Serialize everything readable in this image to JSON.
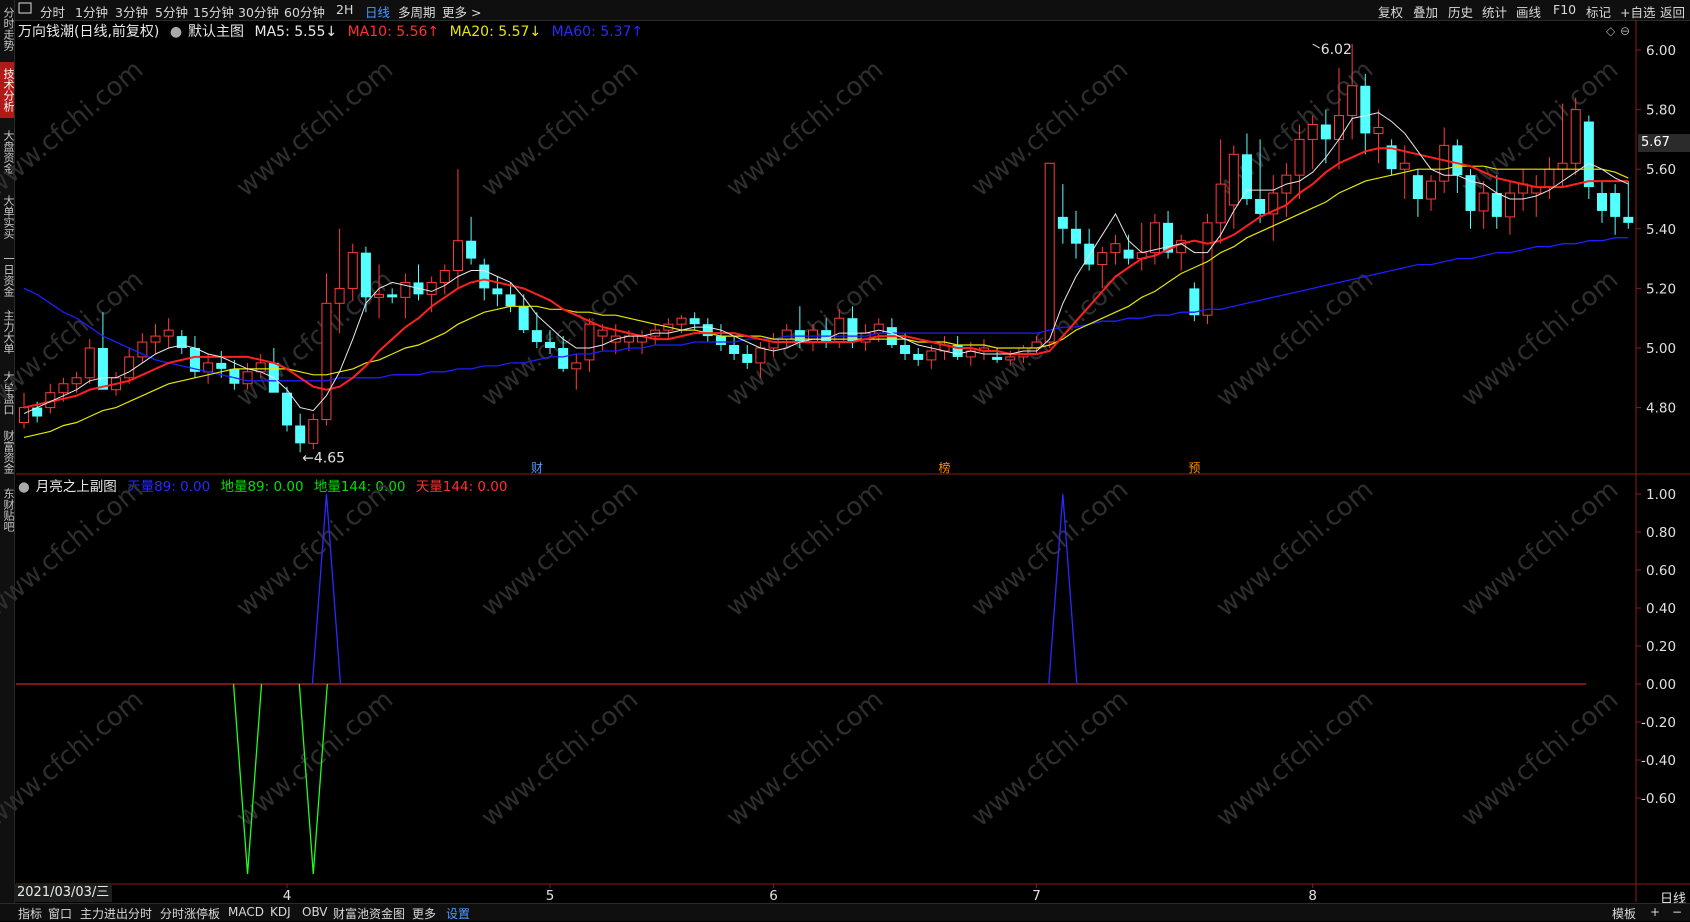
{
  "top_tabs": [
    "分时",
    "1分钟",
    "3分钟",
    "5分钟",
    "15分钟",
    "30分钟",
    "60分钟",
    "2H",
    "日线",
    "多周期",
    "更多 >"
  ],
  "active_tab": "日线",
  "right_menu": [
    "复权",
    "叠加",
    "历史",
    "统计",
    "画线",
    "F10",
    "标记",
    "+自选",
    "返回"
  ],
  "sidebar": [
    "分时走势",
    "技术分析",
    "大盘资金",
    "大单实买",
    "一日资金",
    "主力大单",
    "大单盘口",
    "财富资金",
    "东财贴吧"
  ],
  "active_side": "技术分析",
  "stock_title": "万向钱潮(日线,前复权)",
  "main_indicator": "默认主图",
  "ma": [
    {
      "label": "MA5: 5.55↓",
      "color": "#e8e8e8"
    },
    {
      "label": "MA10: 5.56↑",
      "color": "#ff3030"
    },
    {
      "label": "MA20: 5.57↓",
      "color": "#e6e600"
    },
    {
      "label": "MA60: 5.37↑",
      "color": "#2a2aff"
    }
  ],
  "sub_title": "月亮之上副图",
  "sub_lines": [
    {
      "label": "天量89: 0.00",
      "color": "#2a2aff"
    },
    {
      "label": "地量89: 0.00",
      "color": "#00e000"
    },
    {
      "label": "地量144: 0.00",
      "color": "#00e000"
    },
    {
      "label": "天量144: 0.00",
      "color": "#ff3030"
    }
  ],
  "current_price": "5.67",
  "high_label": "6.02",
  "low_label": "←4.65",
  "event_marks": [
    "财",
    "榜",
    "预"
  ],
  "price_axis": [
    "6.00",
    "5.80",
    "5.60",
    "5.40",
    "5.20",
    "5.00",
    "4.80"
  ],
  "sub_axis": [
    "1.00",
    "0.80",
    "0.60",
    "0.40",
    "0.20",
    "0.00",
    "-0.20",
    "-0.40",
    "-0.60"
  ],
  "x_labels": [
    "4",
    "5",
    "6",
    "7",
    "8"
  ],
  "date_label": "2021/03/03/三",
  "period_label": "日线",
  "bottom_tabs": [
    "指标",
    "窗口",
    "主力进出分时",
    "分时涨停板",
    "MACD",
    "KDJ",
    "OBV",
    "财富池资金图",
    "更多",
    "设置"
  ],
  "active_bottom": "设置",
  "bottom_right": [
    "模板",
    "+",
    "−"
  ],
  "watermark": "www.cfchi.com",
  "colors": {
    "up": "#ff3b3b",
    "down": "#54ffff",
    "ma5": "#e8e8e8",
    "ma10": "#ff2020",
    "ma20": "#e6e600",
    "ma60": "#1e1eff"
  },
  "chart_data": {
    "type": "candlestick",
    "period": "daily",
    "ylim": [
      4.6,
      6.08
    ],
    "candles_ohlc": [
      [
        4.75,
        4.85,
        4.73,
        4.8
      ],
      [
        4.8,
        4.82,
        4.75,
        4.77
      ],
      [
        4.8,
        4.88,
        4.78,
        4.85
      ],
      [
        4.85,
        4.9,
        4.82,
        4.88
      ],
      [
        4.88,
        4.92,
        4.85,
        4.9
      ],
      [
        4.9,
        5.03,
        4.88,
        5.0
      ],
      [
        5.0,
        5.12,
        4.88,
        4.86
      ],
      [
        4.86,
        4.92,
        4.84,
        4.9
      ],
      [
        4.9,
        5.0,
        4.88,
        4.97
      ],
      [
        4.97,
        5.05,
        4.95,
        5.02
      ],
      [
        5.02,
        5.08,
        4.98,
        5.04
      ],
      [
        5.04,
        5.1,
        5.0,
        5.06
      ],
      [
        5.04,
        5.06,
        4.98,
        5.0
      ],
      [
        5.0,
        5.04,
        4.9,
        4.92
      ],
      [
        4.92,
        4.98,
        4.88,
        4.95
      ],
      [
        4.95,
        4.99,
        4.9,
        4.93
      ],
      [
        4.93,
        4.96,
        4.86,
        4.88
      ],
      [
        4.88,
        4.95,
        4.86,
        4.92
      ],
      [
        4.92,
        4.98,
        4.9,
        4.95
      ],
      [
        4.95,
        5.0,
        4.88,
        4.85
      ],
      [
        4.85,
        4.87,
        4.72,
        4.74
      ],
      [
        4.74,
        4.78,
        4.65,
        4.68
      ],
      [
        4.68,
        4.78,
        4.66,
        4.76
      ],
      [
        4.76,
        5.25,
        4.74,
        5.15
      ],
      [
        5.15,
        5.4,
        5.05,
        5.2
      ],
      [
        5.2,
        5.35,
        5.16,
        5.32
      ],
      [
        5.32,
        5.34,
        5.12,
        5.17
      ],
      [
        5.17,
        5.28,
        5.1,
        5.18
      ],
      [
        5.18,
        5.2,
        5.15,
        5.17
      ],
      [
        5.17,
        5.25,
        5.1,
        5.22
      ],
      [
        5.22,
        5.28,
        5.16,
        5.18
      ],
      [
        5.18,
        5.24,
        5.12,
        5.22
      ],
      [
        5.22,
        5.28,
        5.18,
        5.26
      ],
      [
        5.26,
        5.6,
        5.2,
        5.36
      ],
      [
        5.36,
        5.44,
        5.28,
        5.3
      ],
      [
        5.28,
        5.3,
        5.16,
        5.2
      ],
      [
        5.2,
        5.24,
        5.14,
        5.18
      ],
      [
        5.18,
        5.22,
        5.12,
        5.14
      ],
      [
        5.14,
        5.18,
        5.05,
        5.06
      ],
      [
        5.06,
        5.12,
        5.0,
        5.02
      ],
      [
        5.02,
        5.06,
        4.98,
        5.0
      ],
      [
        5.0,
        5.04,
        4.92,
        4.93
      ],
      [
        4.93,
        4.98,
        4.86,
        4.95
      ],
      [
        4.96,
        5.1,
        4.92,
        5.08
      ],
      [
        5.04,
        5.08,
        4.99,
        5.06
      ],
      [
        5.02,
        5.08,
        4.98,
        5.04
      ],
      [
        5.02,
        5.06,
        4.99,
        5.04
      ],
      [
        5.02,
        5.06,
        4.98,
        5.04
      ],
      [
        5.04,
        5.08,
        5.01,
        5.06
      ],
      [
        5.06,
        5.1,
        5.03,
        5.08
      ],
      [
        5.08,
        5.11,
        5.05,
        5.1
      ],
      [
        5.1,
        5.12,
        5.06,
        5.08
      ],
      [
        5.08,
        5.1,
        5.02,
        5.04
      ],
      [
        5.04,
        5.08,
        4.99,
        5.01
      ],
      [
        5.01,
        5.04,
        4.96,
        4.98
      ],
      [
        4.98,
        5.01,
        4.93,
        4.95
      ],
      [
        4.95,
        5.02,
        4.9,
        5.0
      ],
      [
        5.0,
        5.05,
        4.97,
        5.03
      ],
      [
        5.03,
        5.08,
        5.0,
        5.06
      ],
      [
        5.06,
        5.14,
        5.0,
        5.02
      ],
      [
        5.02,
        5.08,
        4.99,
        5.06
      ],
      [
        5.06,
        5.1,
        5.0,
        5.02
      ],
      [
        5.02,
        5.13,
        5.0,
        5.1
      ],
      [
        5.1,
        5.14,
        5.0,
        5.02
      ],
      [
        5.02,
        5.08,
        4.99,
        5.05
      ],
      [
        5.05,
        5.1,
        5.02,
        5.08
      ],
      [
        5.07,
        5.1,
        5.0,
        5.01
      ],
      [
        5.01,
        5.05,
        4.96,
        4.98
      ],
      [
        4.98,
        5.0,
        4.94,
        4.96
      ],
      [
        4.96,
        5.01,
        4.93,
        4.99
      ],
      [
        4.99,
        5.04,
        4.96,
        5.01
      ],
      [
        5.01,
        5.04,
        4.96,
        4.97
      ],
      [
        4.97,
        5.02,
        4.94,
        4.99
      ],
      [
        4.99,
        5.03,
        4.96,
        5.0
      ],
      [
        4.97,
        5.0,
        4.95,
        4.96
      ],
      [
        4.96,
        4.99,
        4.94,
        4.97
      ],
      [
        4.97,
        5.01,
        4.95,
        5.0
      ],
      [
        5.0,
        5.04,
        4.98,
        5.02
      ],
      [
        5.02,
        5.62,
        5.0,
        5.62
      ],
      [
        5.44,
        5.55,
        5.35,
        5.4
      ],
      [
        5.4,
        5.46,
        5.3,
        5.35
      ],
      [
        5.35,
        5.4,
        5.26,
        5.28
      ],
      [
        5.28,
        5.34,
        5.2,
        5.32
      ],
      [
        5.32,
        5.38,
        5.28,
        5.35
      ],
      [
        5.33,
        5.38,
        5.28,
        5.3
      ],
      [
        5.3,
        5.42,
        5.26,
        5.32
      ],
      [
        5.32,
        5.45,
        5.28,
        5.42
      ],
      [
        5.42,
        5.46,
        5.3,
        5.32
      ],
      [
        5.32,
        5.38,
        5.26,
        5.36
      ],
      [
        5.2,
        5.22,
        5.09,
        5.11
      ],
      [
        5.11,
        5.45,
        5.08,
        5.42
      ],
      [
        5.42,
        5.7,
        5.35,
        5.55
      ],
      [
        5.48,
        5.68,
        5.4,
        5.65
      ],
      [
        5.65,
        5.72,
        5.48,
        5.5
      ],
      [
        5.5,
        5.7,
        5.42,
        5.45
      ],
      [
        5.45,
        5.58,
        5.36,
        5.52
      ],
      [
        5.52,
        5.62,
        5.44,
        5.58
      ],
      [
        5.58,
        5.75,
        5.5,
        5.7
      ],
      [
        5.7,
        5.78,
        5.6,
        5.75
      ],
      [
        5.75,
        5.8,
        5.62,
        5.7
      ],
      [
        5.7,
        5.94,
        5.6,
        5.78
      ],
      [
        5.78,
        6.02,
        5.7,
        5.88
      ],
      [
        5.88,
        5.92,
        5.65,
        5.72
      ],
      [
        5.72,
        5.8,
        5.62,
        5.74
      ],
      [
        5.68,
        5.7,
        5.58,
        5.6
      ],
      [
        5.6,
        5.68,
        5.5,
        5.62
      ],
      [
        5.58,
        5.6,
        5.44,
        5.5
      ],
      [
        5.5,
        5.58,
        5.46,
        5.56
      ],
      [
        5.56,
        5.74,
        5.52,
        5.68
      ],
      [
        5.68,
        5.7,
        5.52,
        5.58
      ],
      [
        5.58,
        5.6,
        5.4,
        5.46
      ],
      [
        5.46,
        5.56,
        5.4,
        5.52
      ],
      [
        5.52,
        5.58,
        5.4,
        5.44
      ],
      [
        5.44,
        5.56,
        5.38,
        5.52
      ],
      [
        5.52,
        5.6,
        5.46,
        5.55
      ],
      [
        5.52,
        5.58,
        5.44,
        5.54
      ],
      [
        5.54,
        5.64,
        5.5,
        5.6
      ],
      [
        5.6,
        5.82,
        5.54,
        5.62
      ],
      [
        5.62,
        5.84,
        5.58,
        5.8
      ],
      [
        5.76,
        5.78,
        5.5,
        5.54
      ],
      [
        5.52,
        5.56,
        5.42,
        5.46
      ],
      [
        5.52,
        5.55,
        5.38,
        5.44
      ],
      [
        5.44,
        5.56,
        5.4,
        5.42
      ]
    ],
    "ma5": [
      4.78,
      4.8,
      4.82,
      4.84,
      4.86,
      4.89,
      4.9,
      4.9,
      4.92,
      4.95,
      4.98,
      5.0,
      5.01,
      5.0,
      4.98,
      4.97,
      4.95,
      4.93,
      4.92,
      4.9,
      4.86,
      4.8,
      4.79,
      4.84,
      4.92,
      5.03,
      5.15,
      5.2,
      5.22,
      5.21,
      5.2,
      5.19,
      5.21,
      5.24,
      5.26,
      5.26,
      5.24,
      5.22,
      5.17,
      5.11,
      5.07,
      5.03,
      5.0,
      5.0,
      5.01,
      5.03,
      5.04,
      5.04,
      5.05,
      5.05,
      5.06,
      5.07,
      5.07,
      5.06,
      5.04,
      5.02,
      5.0,
      4.99,
      5.0,
      5.02,
      5.03,
      5.03,
      5.05,
      5.05,
      5.05,
      5.06,
      5.05,
      5.03,
      5.01,
      5.0,
      4.99,
      4.98,
      4.99,
      4.98,
      4.98,
      4.98,
      4.99,
      4.99,
      5.03,
      5.15,
      5.24,
      5.31,
      5.38,
      5.45,
      5.36,
      5.32,
      5.33,
      5.34,
      5.35,
      5.32,
      5.32,
      5.38,
      5.46,
      5.53,
      5.53,
      5.53,
      5.55,
      5.56,
      5.59,
      5.64,
      5.7,
      5.77,
      5.78,
      5.79,
      5.76,
      5.72,
      5.66,
      5.6,
      5.58,
      5.58,
      5.56,
      5.55,
      5.52,
      5.5,
      5.5,
      5.51,
      5.53,
      5.56,
      5.59,
      5.62,
      5.6,
      5.57,
      5.55
    ],
    "ma10": [
      4.8,
      4.81,
      4.82,
      4.83,
      4.84,
      4.86,
      4.87,
      4.88,
      4.89,
      4.91,
      4.93,
      4.95,
      4.96,
      4.97,
      4.97,
      4.97,
      4.97,
      4.97,
      4.96,
      4.95,
      4.93,
      4.9,
      4.87,
      4.86,
      4.87,
      4.9,
      4.94,
      4.99,
      5.03,
      5.07,
      5.1,
      5.14,
      5.17,
      5.2,
      5.22,
      5.23,
      5.22,
      5.21,
      5.2,
      5.18,
      5.16,
      5.13,
      5.11,
      5.09,
      5.07,
      5.06,
      5.05,
      5.04,
      5.03,
      5.03,
      5.04,
      5.05,
      5.05,
      5.05,
      5.05,
      5.04,
      5.03,
      5.02,
      5.02,
      5.02,
      5.02,
      5.02,
      5.02,
      5.02,
      5.03,
      5.04,
      5.04,
      5.04,
      5.03,
      5.02,
      5.01,
      5.0,
      5.0,
      4.99,
      4.99,
      4.98,
      4.98,
      4.98,
      4.99,
      5.04,
      5.09,
      5.14,
      5.19,
      5.24,
      5.27,
      5.3,
      5.31,
      5.33,
      5.35,
      5.36,
      5.35,
      5.36,
      5.38,
      5.41,
      5.44,
      5.46,
      5.48,
      5.52,
      5.55,
      5.59,
      5.62,
      5.64,
      5.66,
      5.67,
      5.67,
      5.66,
      5.65,
      5.64,
      5.63,
      5.62,
      5.61,
      5.59,
      5.57,
      5.56,
      5.55,
      5.54,
      5.54,
      5.54,
      5.55,
      5.56,
      5.56,
      5.56,
      5.56
    ],
    "ma20": [
      4.7,
      4.71,
      4.72,
      4.74,
      4.75,
      4.77,
      4.79,
      4.8,
      4.82,
      4.84,
      4.86,
      4.88,
      4.89,
      4.9,
      4.91,
      4.92,
      4.93,
      4.93,
      4.93,
      4.93,
      4.93,
      4.92,
      4.91,
      4.91,
      4.92,
      4.93,
      4.95,
      4.96,
      4.98,
      5.0,
      5.01,
      5.03,
      5.05,
      5.08,
      5.1,
      5.12,
      5.13,
      5.14,
      5.14,
      5.14,
      5.13,
      5.13,
      5.12,
      5.12,
      5.11,
      5.11,
      5.1,
      5.09,
      5.08,
      5.07,
      5.06,
      5.06,
      5.05,
      5.04,
      5.04,
      5.04,
      5.04,
      5.03,
      5.03,
      5.03,
      5.03,
      5.03,
      5.03,
      5.03,
      5.03,
      5.03,
      5.03,
      5.03,
      5.02,
      5.02,
      5.02,
      5.01,
      5.01,
      5.01,
      5.0,
      5.0,
      5.0,
      5.0,
      5.01,
      5.03,
      5.06,
      5.08,
      5.1,
      5.12,
      5.14,
      5.17,
      5.19,
      5.22,
      5.25,
      5.27,
      5.29,
      5.32,
      5.34,
      5.37,
      5.39,
      5.41,
      5.43,
      5.45,
      5.47,
      5.49,
      5.52,
      5.54,
      5.56,
      5.57,
      5.58,
      5.59,
      5.6,
      5.6,
      5.6,
      5.61,
      5.61,
      5.61,
      5.6,
      5.6,
      5.6,
      5.6,
      5.6,
      5.6,
      5.6,
      5.6,
      5.6,
      5.59,
      5.57
    ],
    "ma60": [
      5.2,
      5.18,
      5.15,
      5.12,
      5.1,
      5.07,
      5.04,
      5.02,
      5.0,
      4.98,
      4.96,
      4.95,
      4.94,
      4.93,
      4.92,
      4.91,
      4.9,
      4.89,
      4.89,
      4.89,
      4.89,
      4.89,
      4.89,
      4.89,
      4.9,
      4.9,
      4.9,
      4.9,
      4.91,
      4.91,
      4.91,
      4.92,
      4.92,
      4.93,
      4.93,
      4.94,
      4.94,
      4.95,
      4.95,
      4.96,
      4.97,
      4.97,
      4.98,
      4.98,
      4.99,
      4.99,
      5.0,
      5.0,
      5.01,
      5.01,
      5.01,
      5.02,
      5.02,
      5.02,
      5.02,
      5.03,
      5.03,
      5.03,
      5.04,
      5.04,
      5.04,
      5.04,
      5.04,
      5.04,
      5.04,
      5.05,
      5.05,
      5.05,
      5.05,
      5.05,
      5.05,
      5.05,
      5.05,
      5.05,
      5.05,
      5.05,
      5.05,
      5.05,
      5.06,
      5.07,
      5.07,
      5.08,
      5.09,
      5.09,
      5.1,
      5.1,
      5.11,
      5.11,
      5.12,
      5.12,
      5.13,
      5.13,
      5.14,
      5.15,
      5.16,
      5.17,
      5.18,
      5.19,
      5.2,
      5.21,
      5.22,
      5.23,
      5.24,
      5.25,
      5.26,
      5.27,
      5.28,
      5.28,
      5.29,
      5.3,
      5.3,
      5.31,
      5.32,
      5.32,
      5.33,
      5.34,
      5.34,
      5.35,
      5.35,
      5.36,
      5.36,
      5.37,
      5.37
    ],
    "sub_indicator": {
      "ylim": [
        -0.85,
        1.05
      ],
      "tian89_spikes": [
        {
          "bar": 23,
          "value": 1.0
        },
        {
          "bar": 79,
          "value": 1.0
        }
      ],
      "di89_spikes": [
        {
          "bar": 17,
          "value": -1.0
        },
        {
          "bar": 22,
          "value": -1.0
        }
      ]
    }
  }
}
